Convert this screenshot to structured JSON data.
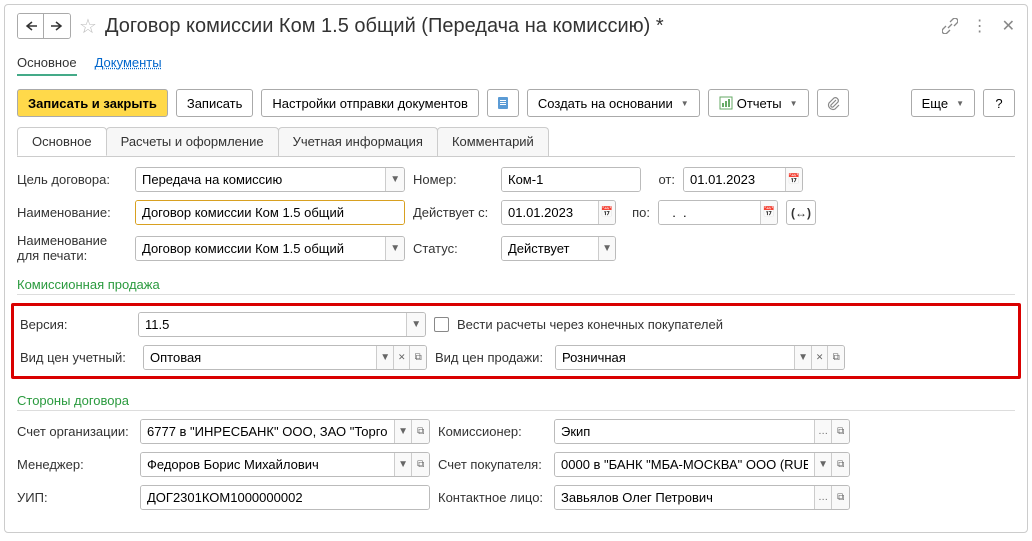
{
  "title": "Договор комиссии Ком 1.5 общий (Передача на комиссию) *",
  "top_tabs": {
    "main": "Основное",
    "docs": "Документы"
  },
  "toolbar": {
    "save_close": "Записать и закрыть",
    "save": "Записать",
    "send_settings": "Настройки отправки документов",
    "create_based": "Создать на основании",
    "reports": "Отчеты",
    "more": "Еще",
    "help": "?"
  },
  "form_tabs": {
    "t1": "Основное",
    "t2": "Расчеты и оформление",
    "t3": "Учетная информация",
    "t4": "Комментарий"
  },
  "labels": {
    "goal": "Цель договора:",
    "number": "Номер:",
    "from": "от:",
    "name": "Наименование:",
    "valid_from": "Действует с:",
    "to": "по:",
    "name_print": "Наименование для печати:",
    "status": "Статус:",
    "section_commission": "Комиссионная продажа",
    "version": "Версия:",
    "calc_via_end": "Вести расчеты через конечных покупателей",
    "price_type_acc": "Вид цен учетный:",
    "price_type_sell": "Вид цен продажи:",
    "section_parties": "Стороны договора",
    "org_account": "Счет организации:",
    "commissioner": "Комиссионер:",
    "manager": "Менеджер:",
    "buyer_account": "Счет покупателя:",
    "uip": "УИП:",
    "contact": "Контактное лицо:"
  },
  "values": {
    "goal": "Передача на комиссию",
    "number": "Ком-1",
    "date_from": "01.01.2023",
    "name": "Договор комиссии Ком 1.5 общий",
    "valid_from": "01.01.2023",
    "valid_to": "  .  .    ",
    "name_print": "Договор комиссии Ком 1.5 общий",
    "status": "Действует",
    "version": "11.5",
    "price_type_acc": "Оптовая",
    "price_type_sell": "Розничная",
    "org_account": "6777 в \"ИНРЕСБАНК\" ООО, ЗАО \"Торго",
    "commissioner": "Экип",
    "manager": "Федоров Борис Михайлович",
    "buyer_account": "0000 в \"БАНК \"МБА-МОСКВА\" ООО (RUB",
    "uip": "ДОГ2301КОМ1000000002",
    "contact": "Завьялов Олег Петрович"
  },
  "ext_btn": "(↔)"
}
